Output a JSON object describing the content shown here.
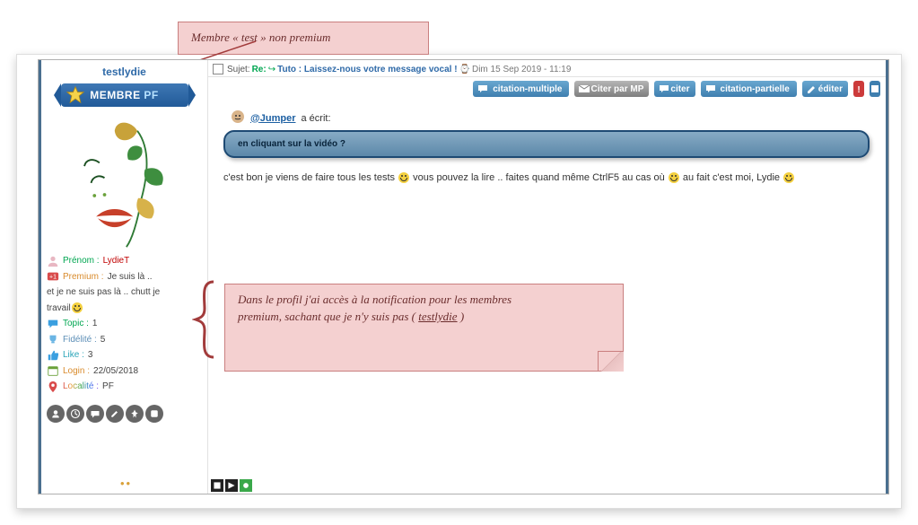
{
  "callouts": {
    "top": "Membre « test » non premium",
    "profile_note_a": "Dans le profil j'ai accès à la notification pour les membres",
    "profile_note_b": "premium, sachant que je n'y suis pas (",
    "profile_note_link": " testlydie",
    "profile_note_c": ")"
  },
  "profile": {
    "username": "testlydie",
    "ribbon_member": "MEMBRE",
    "ribbon_pf": "PF",
    "fields": {
      "prenom_label": "Prénom :",
      "prenom_value": "LydieT",
      "premium_label": "Premium :",
      "premium_value": "Je suis là ..",
      "status_text_a": "et je ne suis pas là .. chutt je",
      "status_text_b": "travail",
      "topic_label": "Topic :",
      "topic_value": "1",
      "fidelite_label": "Fidélité :",
      "fidelite_value": "5",
      "like_label": "Like :",
      "like_value": "3",
      "login_label": "Login :",
      "login_value": "22/05/2018",
      "localite_label": "Localité :",
      "localite_value": "PF"
    }
  },
  "post": {
    "subject_label": "Sujet:",
    "subject_re": "Re:",
    "subject_title": "Tuto : Laissez-nous votre message vocal !",
    "subject_timestamp": "Dim 15 Sep 2019 - 11:19"
  },
  "actions": {
    "multi_quote": "citation-multiple",
    "quote_pm": "Citer par MP",
    "quote": "citer",
    "partial_quote": "citation-partielle",
    "edit": "éditer"
  },
  "quote": {
    "at_prefix": "@",
    "mention": "Jumper",
    "wrote": " a écrit:",
    "content": "en cliquant sur la vidéo ?"
  },
  "body": {
    "p1a": "c'est bon je viens de faire tous les tests ",
    "p1b": " vous pouvez la lire .. faites quand même CtrlF5 au cas où ",
    "p1c": " au fait c'est moi, Lydie "
  }
}
